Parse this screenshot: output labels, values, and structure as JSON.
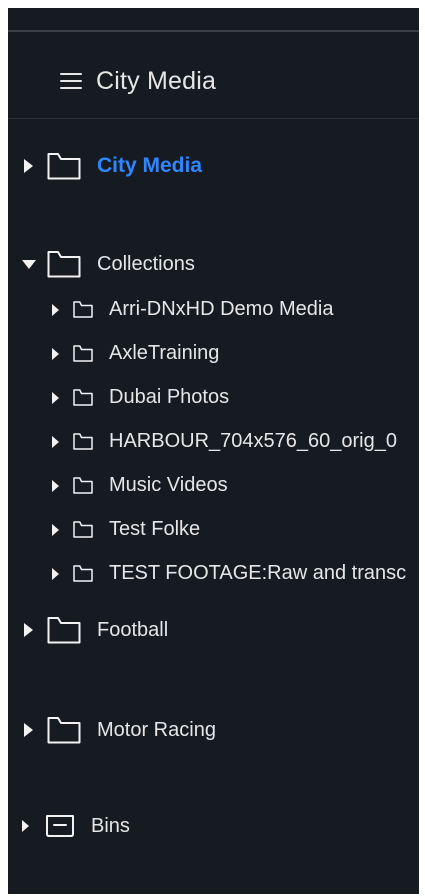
{
  "header": {
    "title": "City Media"
  },
  "tree": {
    "city_media": {
      "label": "City Media",
      "icon": "folder-icon",
      "expanded": false,
      "selected": true
    },
    "collections": {
      "label": "Collections",
      "icon": "folder-icon",
      "expanded": true
    },
    "children": [
      {
        "label": "Arri-DNxHD Demo Media",
        "icon": "folder-icon"
      },
      {
        "label": "AxleTraining",
        "icon": "folder-icon"
      },
      {
        "label": "Dubai Photos",
        "icon": "folder-icon"
      },
      {
        "label": "HARBOUR_704x576_60_orig_0",
        "icon": "folder-icon"
      },
      {
        "label": "Music Videos",
        "icon": "folder-icon"
      },
      {
        "label": "Test Folke",
        "icon": "folder-icon"
      },
      {
        "label": "TEST FOOTAGE:Raw and transc",
        "icon": "folder-icon"
      }
    ],
    "football": {
      "label": "Football",
      "icon": "folder-icon",
      "expanded": false
    },
    "motor_racing": {
      "label": "Motor Racing",
      "icon": "folder-icon",
      "expanded": false
    },
    "bins": {
      "label": "Bins",
      "icon": "bin-icon",
      "expanded": false
    }
  },
  "colors": {
    "panel_bg": "#161b22",
    "text": "#e6e6e6",
    "accent": "#2f86ff"
  }
}
